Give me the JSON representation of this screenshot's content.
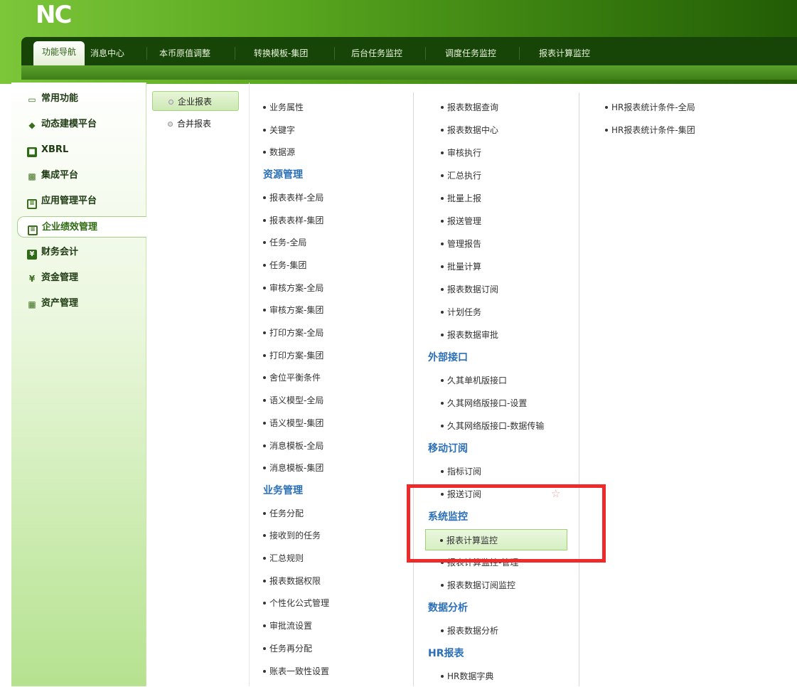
{
  "app": {
    "logo": "NC"
  },
  "tabs": [
    {
      "label": "功能导航",
      "active": true
    },
    {
      "label": "消息中心"
    },
    {
      "label": "本币原值调整"
    },
    {
      "label": "转换模板-集团"
    },
    {
      "label": "后台任务监控"
    },
    {
      "label": "调度任务监控"
    },
    {
      "label": "报表计算监控"
    }
  ],
  "sidebar": [
    {
      "label": "常用功能",
      "icon": "monitor-icon"
    },
    {
      "label": "动态建模平台",
      "icon": "cube-icon"
    },
    {
      "label": "XBRL",
      "icon": "folder-icon"
    },
    {
      "label": "集成平台",
      "icon": "grid-icon"
    },
    {
      "label": "应用管理平台",
      "icon": "app-icon"
    },
    {
      "label": "企业绩效管理",
      "icon": "table-icon",
      "active": true
    },
    {
      "label": "财务会计",
      "icon": "yen-box-icon"
    },
    {
      "label": "资金管理",
      "icon": "yen-icon"
    },
    {
      "label": "资产管理",
      "icon": "asset-icon"
    }
  ],
  "subnav": [
    {
      "label": "企业报表",
      "active": true
    },
    {
      "label": "合并报表"
    }
  ],
  "col1": [
    {
      "t": "item",
      "label": "业务属性"
    },
    {
      "t": "item",
      "label": "关键字"
    },
    {
      "t": "item",
      "label": "数据源"
    },
    {
      "t": "section",
      "label": "资源管理"
    },
    {
      "t": "item",
      "label": "报表表样-全局"
    },
    {
      "t": "item",
      "label": "报表表样-集团"
    },
    {
      "t": "item",
      "label": "任务-全局"
    },
    {
      "t": "item",
      "label": "任务-集团"
    },
    {
      "t": "item",
      "label": "审核方案-全局"
    },
    {
      "t": "item",
      "label": "审核方案-集团"
    },
    {
      "t": "item",
      "label": "打印方案-全局"
    },
    {
      "t": "item",
      "label": "打印方案-集团"
    },
    {
      "t": "item",
      "label": "舍位平衡条件"
    },
    {
      "t": "item",
      "label": "语义模型-全局"
    },
    {
      "t": "item",
      "label": "语义模型-集团"
    },
    {
      "t": "item",
      "label": "消息模板-全局"
    },
    {
      "t": "item",
      "label": "消息模板-集团"
    },
    {
      "t": "section",
      "label": "业务管理"
    },
    {
      "t": "item",
      "label": "任务分配"
    },
    {
      "t": "item",
      "label": "接收到的任务"
    },
    {
      "t": "item",
      "label": "汇总规则"
    },
    {
      "t": "item",
      "label": "报表数据权限"
    },
    {
      "t": "item",
      "label": "个性化公式管理"
    },
    {
      "t": "item",
      "label": "审批流设置"
    },
    {
      "t": "item",
      "label": "任务再分配"
    },
    {
      "t": "item",
      "label": "账表一致性设置"
    }
  ],
  "col2": [
    {
      "t": "item",
      "label": "报表数据查询"
    },
    {
      "t": "item",
      "label": "报表数据中心"
    },
    {
      "t": "item",
      "label": "审核执行"
    },
    {
      "t": "item",
      "label": "汇总执行"
    },
    {
      "t": "item",
      "label": "批量上报"
    },
    {
      "t": "item",
      "label": "报送管理"
    },
    {
      "t": "item",
      "label": "管理报告"
    },
    {
      "t": "item",
      "label": "批量计算"
    },
    {
      "t": "item",
      "label": "报表数据订阅"
    },
    {
      "t": "item",
      "label": "计划任务"
    },
    {
      "t": "item",
      "label": "报表数据审批"
    },
    {
      "t": "section",
      "label": "外部接口"
    },
    {
      "t": "item",
      "label": "久其单机版接口"
    },
    {
      "t": "item",
      "label": "久其网络版接口-设置"
    },
    {
      "t": "item",
      "label": "久其网络版接口-数据传输"
    },
    {
      "t": "section",
      "label": "移动订阅"
    },
    {
      "t": "item",
      "label": "指标订阅"
    },
    {
      "t": "item",
      "label": "报送订阅",
      "star": true
    },
    {
      "t": "section",
      "label": "系统监控"
    },
    {
      "t": "item",
      "label": "报表计算监控",
      "highlight": true
    },
    {
      "t": "item",
      "label": "报表计算监控-管理"
    },
    {
      "t": "item",
      "label": "报表数据订阅监控"
    },
    {
      "t": "section",
      "label": "数据分析"
    },
    {
      "t": "item",
      "label": "报表数据分析"
    },
    {
      "t": "section",
      "label": "HR报表"
    },
    {
      "t": "item",
      "label": "HR数据字典"
    }
  ],
  "col3": [
    {
      "t": "item",
      "label": "HR报表统计条件-全局"
    },
    {
      "t": "item",
      "label": "HR报表统计条件-集团"
    }
  ]
}
